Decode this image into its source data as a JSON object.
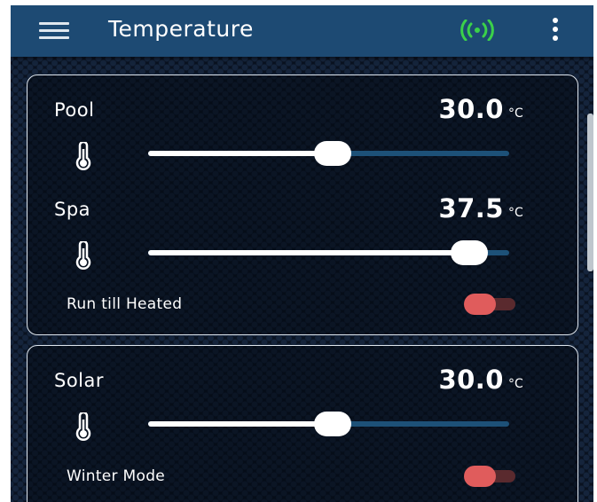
{
  "appbar": {
    "title": "Temperature",
    "menu_icon": "hamburger-menu-icon",
    "status_icon": "wireless-signal-icon",
    "status_color": "#3bd14a",
    "more_icon": "more-vertical-icon"
  },
  "cards": [
    {
      "settings": [
        {
          "label": "Pool",
          "value": "30.0",
          "unit": "°C",
          "slider_fraction": 0.51
        },
        {
          "label": "Spa",
          "value": "37.5",
          "unit": "°C",
          "slider_fraction": 0.89
        }
      ],
      "toggle": {
        "label": "Run till Heated",
        "on": false
      }
    },
    {
      "settings": [
        {
          "label": "Solar",
          "value": "30.0",
          "unit": "°C",
          "slider_fraction": 0.51
        }
      ],
      "toggle": {
        "label": "Winter Mode",
        "on": false
      }
    }
  ],
  "colors": {
    "appbar": "#1d4a73",
    "slider_track": "#1d5178",
    "toggle_thumb": "#e05c5c"
  }
}
